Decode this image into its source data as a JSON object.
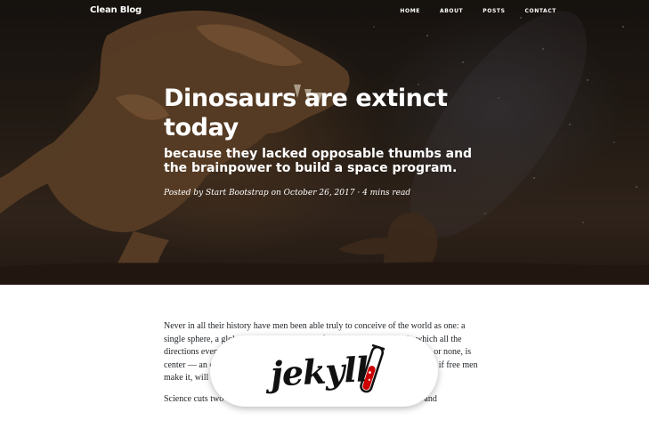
{
  "nav": {
    "brand": "Clean Blog",
    "items": [
      {
        "label": "HOME"
      },
      {
        "label": "ABOUT"
      },
      {
        "label": "POSTS"
      },
      {
        "label": "CONTACT"
      }
    ]
  },
  "post": {
    "title": "Dinosaurs are extinct today",
    "subtitle": "because they lacked opposable thumbs and the brainpower to build a space program.",
    "meta": {
      "prefix": "Posted by",
      "author": "Start Bootstrap",
      "on": "on",
      "date": "October 26, 2017",
      "separator": "·",
      "read_time": "4 mins read"
    }
  },
  "article": {
    "paragraphs": [
      "Never in all their history have men been able truly to conceive of the world as one: a single sphere, a globe, having the qualities of a globe, a round earth in which all the directions eventually meet, in which there is no center because every point, or none, is center — an equal earth which all men occupy as equals. The airman's earth, if free men make it, will be truly round: a globe in practice, not in theory.",
      "Science cuts two ways, of course; its products can be used for both good and"
    ]
  },
  "overlay": {
    "logo_text": "jekyll",
    "colors": {
      "flask": "#cc0000"
    }
  },
  "colors": {
    "hero_overlay": "#000000",
    "text": "#212529"
  }
}
